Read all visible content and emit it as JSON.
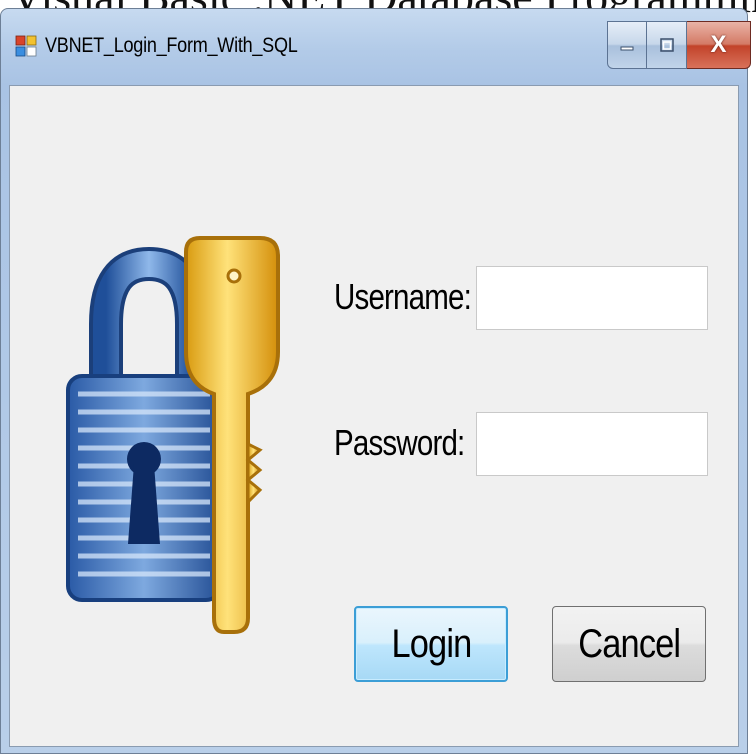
{
  "background_caption": "Visual Basic .NET Database Programming",
  "window": {
    "title": "VBNET_Login_Form_With_SQL",
    "icon": "winforms-app-icon",
    "controls": {
      "minimize_icon": "minimize-icon",
      "maximize_icon": "maximize-icon",
      "close_label": "X"
    }
  },
  "form": {
    "image": "padlock-and-key-icon",
    "username_label": "Username:",
    "username_value": "",
    "password_label": "Password:",
    "password_value": "",
    "login_label": "Login",
    "cancel_label": "Cancel"
  },
  "colors": {
    "accent": "#3c9ed6",
    "lock_blue": "#2b5ea8",
    "key_gold": "#f2c230",
    "close_red": "#c2432a"
  }
}
